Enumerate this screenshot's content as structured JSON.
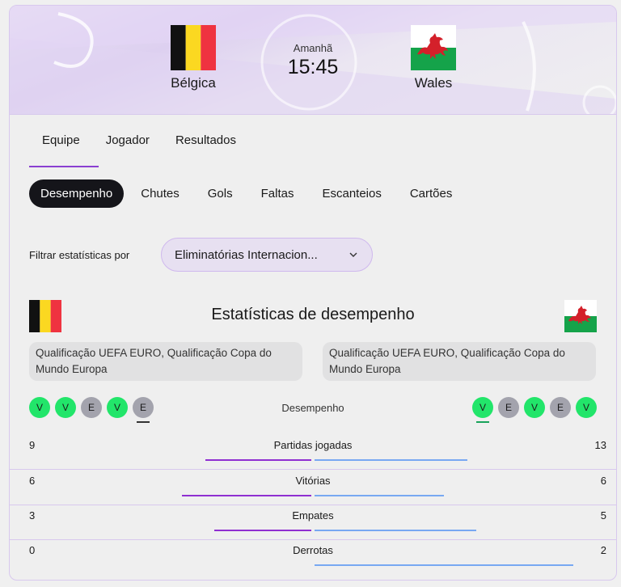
{
  "match": {
    "home_team": "Bélgica",
    "away_team": "Wales",
    "day": "Amanhã",
    "time": "15:45"
  },
  "tabs": [
    {
      "label": "Equipe",
      "active": true
    },
    {
      "label": "Jogador",
      "active": false
    },
    {
      "label": "Resultados",
      "active": false
    }
  ],
  "pills": [
    {
      "label": "Desempenho",
      "active": true
    },
    {
      "label": "Chutes",
      "active": false
    },
    {
      "label": "Gols",
      "active": false
    },
    {
      "label": "Faltas",
      "active": false
    },
    {
      "label": "Escanteios",
      "active": false
    },
    {
      "label": "Cartões",
      "active": false
    }
  ],
  "filter": {
    "label": "Filtrar estatísticas por",
    "selected": "Eliminatórias Internacion..."
  },
  "stats": {
    "title": "Estatísticas de desempenho",
    "home_competitions": "Qualificação UEFA EURO, Qualificação Copa do Mundo Europa",
    "away_competitions": "Qualificação UEFA EURO, Qualificação Copa do Mundo Europa",
    "form_label": "Desempenho",
    "home_form": [
      "V",
      "V",
      "E",
      "V",
      "E"
    ],
    "away_form": [
      "V",
      "E",
      "V",
      "E",
      "V"
    ],
    "rows": [
      {
        "label": "Partidas jogadas",
        "home": "9",
        "away": "13"
      },
      {
        "label": "Vitórias",
        "home": "6",
        "away": "6"
      },
      {
        "label": "Empates",
        "home": "3",
        "away": "5"
      },
      {
        "label": "Derrotas",
        "home": "0",
        "away": "2"
      }
    ]
  },
  "colors": {
    "accent": "#8f2fd1",
    "away_bar": "#78a8f2",
    "win": "#22e56a",
    "draw": "#a3a3ad",
    "active_pill": "#15151a"
  }
}
